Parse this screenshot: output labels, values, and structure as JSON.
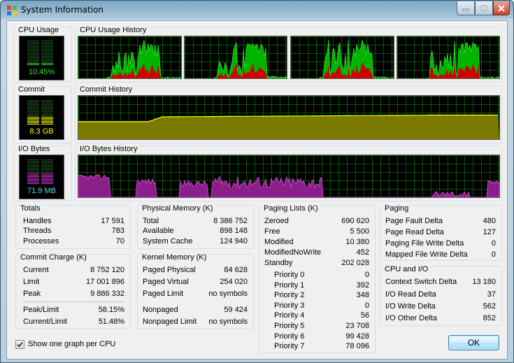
{
  "window": {
    "title": "System Information",
    "controls": {
      "minimize": "minimize",
      "maximize": "maximize",
      "close": "close"
    }
  },
  "graphs": {
    "cpu_usage": {
      "label": "CPU Usage",
      "value": "10.45%",
      "level": 0.1045,
      "color": "#2ee82e"
    },
    "cpu_history": {
      "label": "CPU Usage History",
      "cpu_count": 4
    },
    "commit": {
      "label": "Commit",
      "value": "8.3 GB",
      "level": 0.49,
      "color": "#ffff00"
    },
    "commit_history": {
      "label": "Commit History"
    },
    "io_bytes": {
      "label": "I/O Bytes",
      "value": "71.9  MB",
      "level": 0.5,
      "color": "#cc33cc"
    },
    "io_history": {
      "label": "I/O Bytes History"
    }
  },
  "totals": {
    "label": "Totals",
    "rows": [
      {
        "label": "Handles",
        "value": "17 591"
      },
      {
        "label": "Threads",
        "value": "783"
      },
      {
        "label": "Processes",
        "value": "70"
      }
    ]
  },
  "commit_charge": {
    "label": "Commit Charge (K)",
    "rows": [
      {
        "label": "Current",
        "value": "8 752 120"
      },
      {
        "label": "Limit",
        "value": "17 001 896"
      },
      {
        "label": "Peak",
        "value": "9 886 332"
      }
    ],
    "ratios": [
      {
        "label": "Peak/Limit",
        "value": "58.15%"
      },
      {
        "label": "Current/Limit",
        "value": "51.48%"
      }
    ]
  },
  "physical_memory": {
    "label": "Physical Memory (K)",
    "rows": [
      {
        "label": "Total",
        "value": "8 386 752"
      },
      {
        "label": "Available",
        "value": "898 148"
      },
      {
        "label": "System Cache",
        "value": "124 940"
      }
    ]
  },
  "kernel_memory": {
    "label": "Kernel Memory (K)",
    "rows": [
      {
        "label": "Paged Physical",
        "value": "84 628"
      },
      {
        "label": "Paged Virtual",
        "value": "254 020"
      },
      {
        "label": "Paged Limit",
        "value": "no symbols"
      }
    ],
    "nonpaged": [
      {
        "label": "Nonpaged",
        "value": "59 424"
      },
      {
        "label": "Nonpaged Limit",
        "value": "no symbols"
      }
    ]
  },
  "paging_lists": {
    "label": "Paging Lists (K)",
    "rows": [
      {
        "label": "Zeroed",
        "value": "690 620"
      },
      {
        "label": "Free",
        "value": "5 500"
      },
      {
        "label": "Modified",
        "value": "10 380"
      },
      {
        "label": "ModifiedNoWrite",
        "value": "452"
      },
      {
        "label": "Standby",
        "value": "202 028"
      }
    ],
    "priorities": [
      {
        "label": "Priority 0",
        "value": "0"
      },
      {
        "label": "Priority 1",
        "value": "392"
      },
      {
        "label": "Priority 2",
        "value": "348"
      },
      {
        "label": "Priority 3",
        "value": "0"
      },
      {
        "label": "Priority 4",
        "value": "56"
      },
      {
        "label": "Priority 5",
        "value": "23 708"
      },
      {
        "label": "Priority 6",
        "value": "99 428"
      },
      {
        "label": "Priority 7",
        "value": "78 096"
      }
    ]
  },
  "paging": {
    "label": "Paging",
    "rows": [
      {
        "label": "Page Fault Delta",
        "value": "480"
      },
      {
        "label": "Page Read Delta",
        "value": "127"
      },
      {
        "label": "Paging File Write Delta",
        "value": "0"
      },
      {
        "label": "Mapped File Write Delta",
        "value": "0"
      }
    ]
  },
  "cpu_io": {
    "label": "CPU and I/O",
    "rows": [
      {
        "label": "Context Switch Delta",
        "value": "13 180"
      },
      {
        "label": "I/O Read Delta",
        "value": "37"
      },
      {
        "label": "I/O Write Delta",
        "value": "562"
      },
      {
        "label": "I/O Other Delta",
        "value": "852"
      }
    ]
  },
  "options": {
    "one_graph_per_cpu": "Show one graph per CPU",
    "one_graph_per_cpu_checked": true
  },
  "buttons": {
    "ok": "OK"
  },
  "colors": {
    "grid": "#005a00",
    "cpu_fill": "#00b400",
    "cpu_kernel": "#d00000",
    "commit_fill": "#7a7a00",
    "commit_line": "#ffff00",
    "io_fill": "#8a1f8a",
    "io_line": "#cc44cc"
  }
}
